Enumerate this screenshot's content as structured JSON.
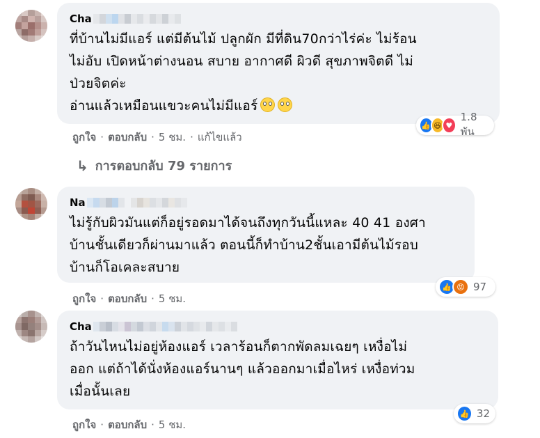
{
  "comments": [
    {
      "author": "Cha",
      "author_pixelated": true,
      "text": "ที่บ้านไม่มีแอร์ แต่มีต้นไม้ ปลูกผัก มีที่ดิน70กว่าไร่ค่ะ ไม่ร้อน\nไม่อับ เปิดหน้าต่างนอน สบาย อากาศดี ผิวดี สุขภาพจิตดี ไม่\nป่วยจิตค่ะ\nอ่านแล้วเหมือนแขวะคนไม่มีแอร์",
      "emojis": [
        "face-with-rolling-eyes",
        "face-with-rolling-eyes"
      ],
      "reactions": {
        "icons": [
          "like-icon",
          "haha-icon",
          "love-icon"
        ],
        "count": "1.8 พัน"
      },
      "actions": {
        "like": "ถูกใจ",
        "reply": "ตอบกลับ",
        "time": "5 ชม.",
        "edited": "แก้ไขแล้ว"
      },
      "replies_label": "การตอบกลับ 79 รายการ"
    },
    {
      "author": "Na",
      "author_pixelated": true,
      "text": "ไม่รู้กับผิวมันแต่ก็อยู่รอดมาได้จนถึงทุกวันนี้แหละ 40 41 องศา\nบ้านชั้นเดียวก็ผ่านมาแล้ว ตอนนี้ก็ทำบ้าน2ชั้นเอามีต้นไม้รอบ\nบ้านก็โอเคละสบาย",
      "reactions": {
        "icons": [
          "like-icon",
          "angry-icon"
        ],
        "count": "97"
      },
      "actions": {
        "like": "ถูกใจ",
        "reply": "ตอบกลับ",
        "time": "5 ชม."
      }
    },
    {
      "author": "Cha",
      "author_pixelated": true,
      "text": "ถ้าวันไหนไม่อยู่ห้องแอร์ เวลาร้อนก็ตากพัดลมเฉยๆ เหงื่อไม่\nออก แต่ถ้าได้นั่งห้องแอร์นานๆ แล้วออกมาเมื่อไหร่ เหงื่อท่วม\nเมื่อนั้นเลย",
      "reactions": {
        "icons": [
          "like-icon"
        ],
        "count": "32"
      },
      "actions": {
        "like": "ถูกใจ",
        "reply": "ตอบกลับ",
        "time": "5 ชม."
      }
    }
  ],
  "colors": {
    "bubble": "#f0f2f5",
    "secondary_text": "#65676b",
    "like": "#1877f2",
    "love": "#f33e58",
    "haha": "#f7b928",
    "angry": "#e9710f"
  }
}
